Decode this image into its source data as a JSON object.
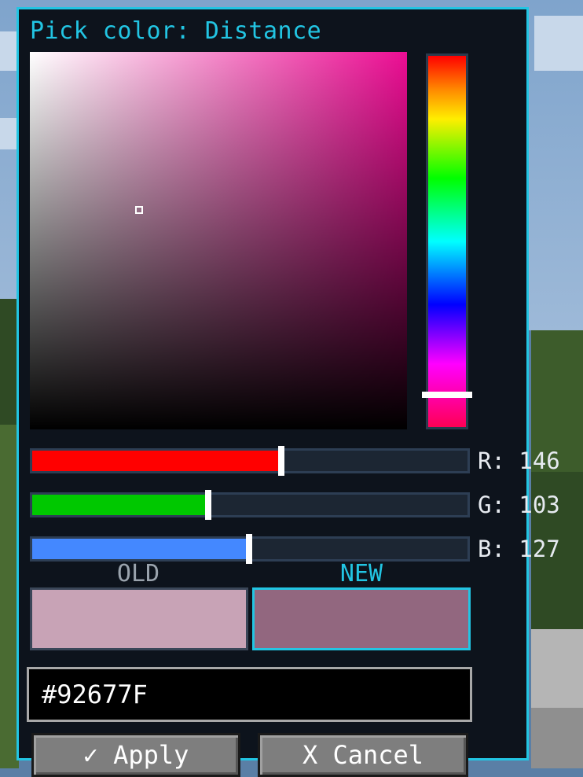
{
  "dialog": {
    "title": "Pick color: Distance"
  },
  "picker": {
    "accent_color": "#22c5e3",
    "hue_color": "#ec0d93",
    "saturation": 0.32,
    "value": 0.57,
    "hue_position": 0.9
  },
  "sliders": {
    "r": {
      "label": "R: 146",
      "value": 146,
      "color": "#ff0000"
    },
    "g": {
      "label": "G: 103",
      "value": 103,
      "color": "#00c800"
    },
    "b": {
      "label": "B: 127",
      "value": 127,
      "color": "#4488ff"
    }
  },
  "preview": {
    "old_label": "OLD",
    "new_label": "NEW",
    "old_color": "#c8a3b6",
    "new_color": "#92677f"
  },
  "hex": {
    "value": "#92677F"
  },
  "buttons": {
    "apply": "✓ Apply",
    "cancel": "X Cancel"
  }
}
